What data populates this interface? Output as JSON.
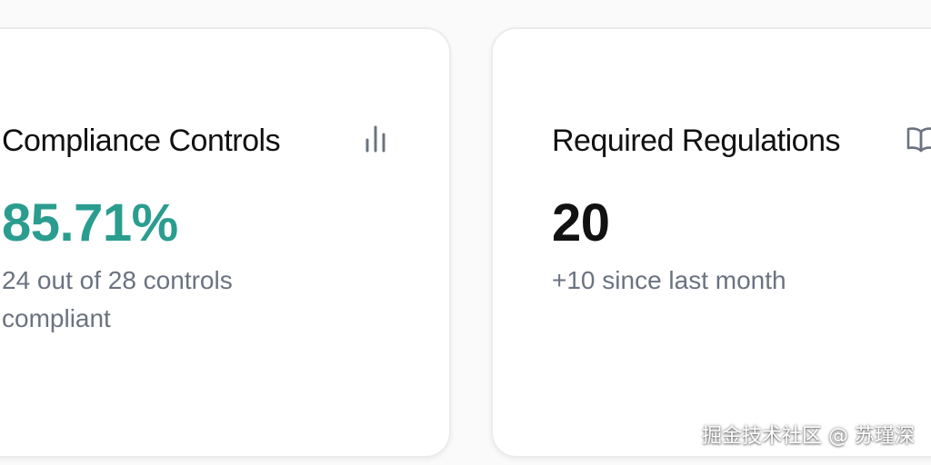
{
  "cards": [
    {
      "title": "Compliance Controls",
      "value": "85.71%",
      "subtitle": "24 out of 28 controls compliant",
      "icon": "bar-chart-icon",
      "value_color": "#2a9d8f",
      "compliant_fraction": 0.8571
    },
    {
      "title": "Required Regulations",
      "value": "20",
      "subtitle": "+10 since last month",
      "icon": "book-open-icon",
      "value_color": "#111111"
    }
  ],
  "watermark": "掘金技术社区 @ 苏瑾深"
}
